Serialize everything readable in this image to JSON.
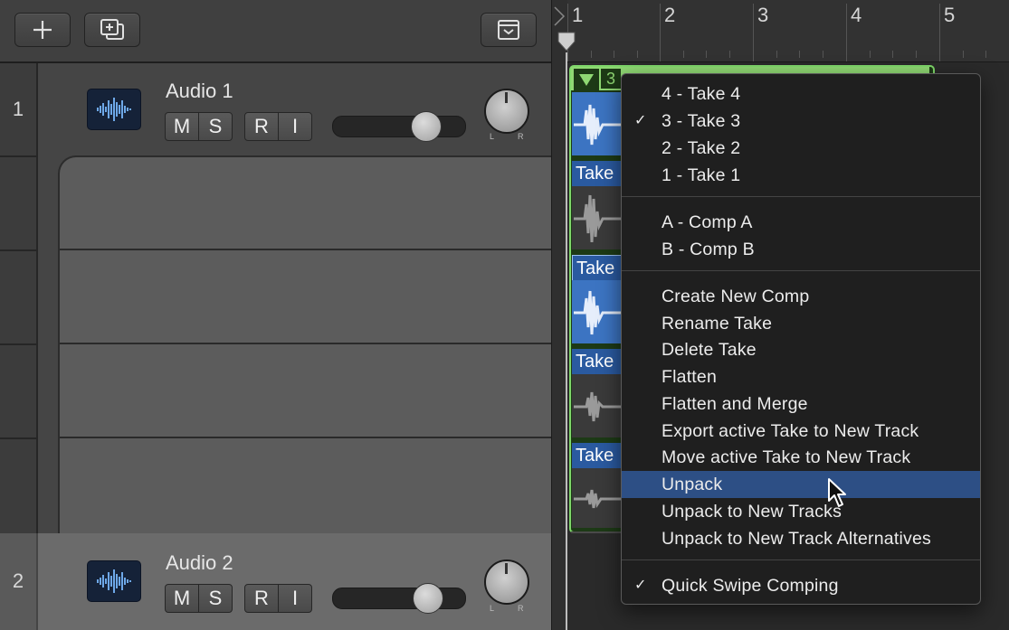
{
  "ruler": {
    "bars": [
      "1",
      "2",
      "3",
      "4",
      "5"
    ]
  },
  "tracks": [
    {
      "number": "1",
      "name": "Audio 1",
      "buttons": [
        "M",
        "S",
        "R",
        "I"
      ],
      "pan_left": "L",
      "pan_right": "R"
    },
    {
      "number": "2",
      "name": "Audio 2",
      "buttons": [
        "M",
        "S",
        "R",
        "I"
      ],
      "pan_left": "L",
      "pan_right": "R"
    }
  ],
  "take_folder": {
    "take_number": "3",
    "take_labels": [
      "Take",
      "Take",
      "Take",
      "Take"
    ]
  },
  "menu": {
    "takes": [
      {
        "label": "4 - Take 4",
        "checked": false
      },
      {
        "label": "3 - Take 3",
        "checked": true
      },
      {
        "label": "2 - Take 2",
        "checked": false
      },
      {
        "label": "1 - Take 1",
        "checked": false
      }
    ],
    "comps": [
      "A - Comp A",
      "B - Comp B"
    ],
    "actions": [
      "Create New Comp",
      "Rename Take",
      "Delete Take",
      "Flatten",
      "Flatten and Merge",
      "Export active Take to New Track",
      "Move active Take to New Track",
      "Unpack",
      "Unpack to New Tracks",
      "Unpack to New Track Alternatives"
    ],
    "highlighted": "Unpack",
    "quick_swipe": {
      "label": "Quick Swipe Comping",
      "checked": true
    },
    "check_glyph": "✓"
  },
  "colors": {
    "region_border": "#7fd86a",
    "take_label": "#2a5aa0",
    "menu_highlight": "#2d4f85"
  }
}
